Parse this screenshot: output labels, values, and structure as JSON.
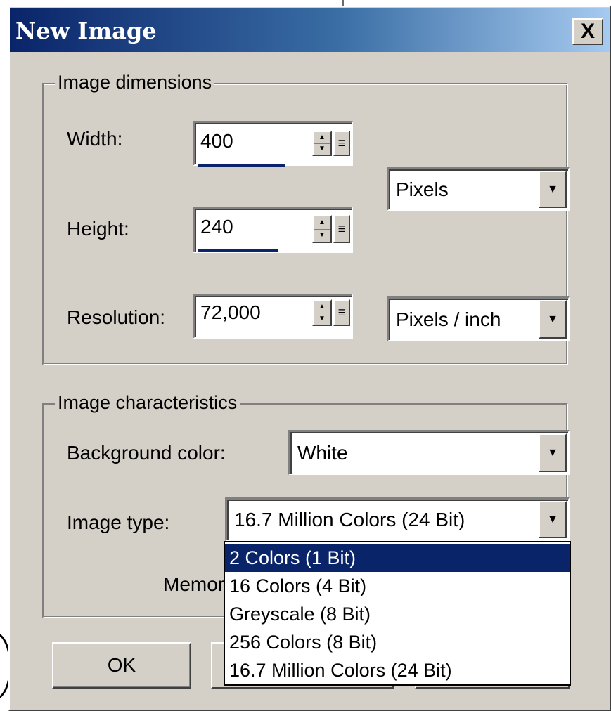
{
  "window": {
    "title": "New Image",
    "close_glyph": "X"
  },
  "dimensions_group": {
    "legend": "Image dimensions",
    "width": {
      "label": "Width:",
      "value": "400"
    },
    "height": {
      "label": "Height:",
      "value": "240"
    },
    "resolution": {
      "label": "Resolution:",
      "value": "72,000"
    },
    "size_unit": {
      "selected": "Pixels"
    },
    "resolution_unit": {
      "selected": "Pixels / inch"
    }
  },
  "characteristics_group": {
    "legend": "Image characteristics",
    "background_color": {
      "label": "Background color:",
      "selected": "White"
    },
    "image_type": {
      "label": "Image type:",
      "selected": "16.7 Million Colors (24 Bit)",
      "options": [
        "2 Colors (1 Bit)",
        "16 Colors (4 Bit)",
        "Greyscale (8 Bit)",
        "256 Colors (8 Bit)",
        "16.7 Million Colors (24 Bit)"
      ],
      "highlighted_index": 0
    },
    "memory_label_partial": "Memor"
  },
  "buttons": {
    "ok_label": "OK"
  },
  "icons": {
    "close": "close-icon",
    "spin_up": "spin-up-arrow-icon",
    "spin_down": "spin-down-arrow-icon",
    "dropdown": "chevron-down-icon"
  },
  "colors": {
    "title_gradient_start": "#0a246a",
    "title_gradient_end": "#a6caf0",
    "selection": "#0a246a",
    "dialog_face": "#d4d0c8"
  }
}
